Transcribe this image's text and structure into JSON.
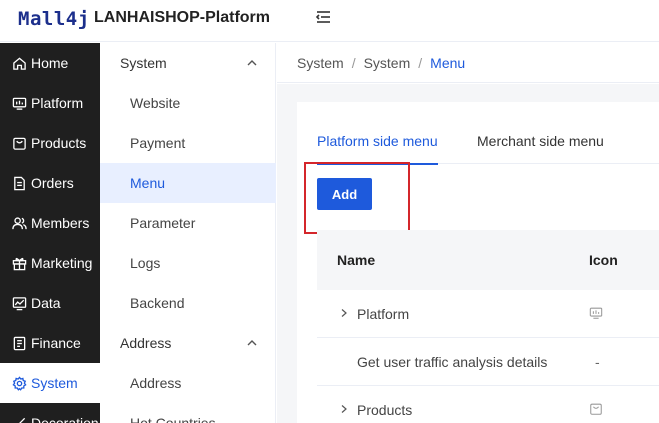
{
  "header": {
    "logo_text": "Mall4j",
    "title": "LANHAISHOP-Platform",
    "collapse_icon": "menu-fold-icon"
  },
  "sidebar": {
    "items": [
      {
        "label": "Home",
        "icon": "home-icon"
      },
      {
        "label": "Platform",
        "icon": "monitor-icon"
      },
      {
        "label": "Products",
        "icon": "bag-icon"
      },
      {
        "label": "Orders",
        "icon": "document-icon"
      },
      {
        "label": "Members",
        "icon": "users-icon"
      },
      {
        "label": "Marketing",
        "icon": "gift-icon"
      },
      {
        "label": "Data",
        "icon": "chart-icon"
      },
      {
        "label": "Finance",
        "icon": "ledger-icon"
      },
      {
        "label": "System",
        "icon": "gear-icon",
        "active": true
      },
      {
        "label": "Decoration",
        "icon": "brush-icon"
      }
    ]
  },
  "subnav": {
    "group_system": "System",
    "system_items": [
      "Website",
      "Payment",
      "Menu",
      "Parameter",
      "Logs",
      "Backend"
    ],
    "group_address": "Address",
    "address_items": [
      "Address",
      "Hot Countries"
    ],
    "active_item": "Menu"
  },
  "breadcrumb": {
    "items": [
      "System",
      "System"
    ],
    "current": "Menu",
    "separator": "/"
  },
  "tabs": {
    "platform": "Platform side menu",
    "merchant": "Merchant side menu",
    "active": "platform"
  },
  "actions": {
    "add_label": "Add"
  },
  "table": {
    "headers": {
      "name": "Name",
      "icon": "Icon"
    },
    "rows": [
      {
        "name": "Platform",
        "expandable": true,
        "icon": "monitor-icon"
      },
      {
        "name": "Get user traffic analysis details",
        "expandable": false,
        "icon_text": "-"
      },
      {
        "name": "Products",
        "expandable": true,
        "icon": "bag-icon"
      }
    ]
  },
  "colors": {
    "accent": "#1e5adc",
    "sidebar_bg": "#1f1f1f",
    "highlight": "#d4262b",
    "active_sub_bg": "#e8efff"
  }
}
